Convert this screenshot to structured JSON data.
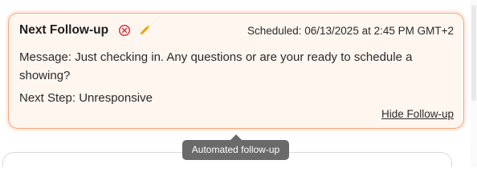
{
  "followup": {
    "title": "Next Follow-up",
    "scheduled": "Scheduled: 06/13/2025 at 2:45 PM GMT+2",
    "message": "Message: Just checking in. Any questions or are your ready to schedule a showing?",
    "next_step": "Next Step: Unresponsive",
    "hide_link": "Hide Follow-up",
    "icons": {
      "cancel": "circle-x-icon",
      "edit": "pencil-icon"
    },
    "colors": {
      "card_border": "#f4a57a",
      "card_background": "#fff6f0",
      "cancel_icon": "#d9363e",
      "edit_icon": "#f0a500"
    }
  },
  "tooltip": {
    "text": "Automated follow-up",
    "background": "#6a6a6a"
  }
}
